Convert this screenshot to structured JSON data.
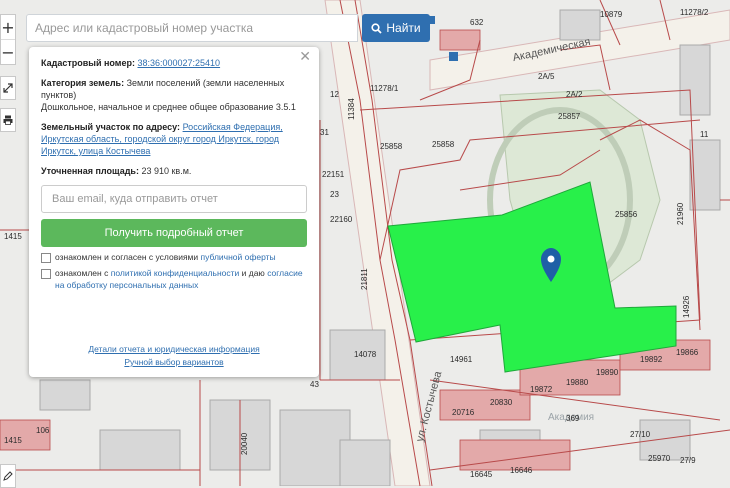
{
  "search": {
    "placeholder": "Адрес или кадастровый номер участка",
    "button_label": "Найти"
  },
  "controls": {
    "zoom_in": "+",
    "zoom_out": "−"
  },
  "popup": {
    "cadastral_label": "Кадастровый номер:",
    "cadastral_number": "38:36:000027:25410",
    "category_label": "Категория земель:",
    "category_value": "Земли поселений (земли населенных пунктов)",
    "category_desc": "Дошкольное, начальное и среднее общее образование 3.5.1",
    "address_label": "Земельный участок по адресу:",
    "address_value": "Российская Федерация, Иркутская область, городской округ город Иркутск, город Иркутск, улица Костычева",
    "area_label": "Уточненная площадь:",
    "area_value": "23 910 кв.м.",
    "email_placeholder": "Ваш email, куда отправить отчет",
    "report_button": "Получить подробный отчет",
    "consent1_text": "ознакомлен и согласен с условиями",
    "consent1_link": "публичной оферты",
    "consent2_text": "ознакомлен с",
    "consent2_link1": "политикой конфиденциальности",
    "consent2_mid": "и даю",
    "consent2_link2": "согласие на обработку персональных данных",
    "footer_link1": "Детали отчета и юридическая информация",
    "footer_link2": "Ручной выбор вариантов"
  },
  "map": {
    "street_name": "Академическая",
    "street_name_2": "ул. Костычева",
    "faded_label": "Академия",
    "labels": [
      {
        "text": "10879"
      },
      {
        "text": "11278/2"
      },
      {
        "text": "632"
      },
      {
        "text": "11278/1"
      },
      {
        "text": "2А/5"
      },
      {
        "text": "2А/2"
      },
      {
        "text": "25857"
      },
      {
        "text": "25858"
      },
      {
        "text": "25858"
      },
      {
        "text": "22151"
      },
      {
        "text": "22160"
      },
      {
        "text": "25856"
      },
      {
        "text": "14078"
      },
      {
        "text": "14961"
      },
      {
        "text": "19872"
      },
      {
        "text": "19880"
      },
      {
        "text": "19890"
      },
      {
        "text": "19892"
      },
      {
        "text": "19866"
      },
      {
        "text": "20716"
      },
      {
        "text": "20830"
      },
      {
        "text": "369"
      },
      {
        "text": "27/10"
      },
      {
        "text": "106"
      },
      {
        "text": "43"
      },
      {
        "text": "16645"
      },
      {
        "text": "16646"
      },
      {
        "text": "25970"
      },
      {
        "text": "1415"
      },
      {
        "text": "1415"
      },
      {
        "text": "11384"
      },
      {
        "text": "21811"
      },
      {
        "text": "21960"
      },
      {
        "text": "14926"
      },
      {
        "text": "20040"
      },
      {
        "text": "12"
      },
      {
        "text": "23"
      },
      {
        "text": "27/9"
      },
      {
        "text": "31"
      },
      {
        "text": "11"
      }
    ]
  },
  "colors": {
    "parcel": "#28f04a",
    "marker": "#1f5fa6",
    "boundary": "#b84a4a",
    "building": "#e3a9a9",
    "accent": "#2f6fb0",
    "report": "#5cb85c"
  }
}
